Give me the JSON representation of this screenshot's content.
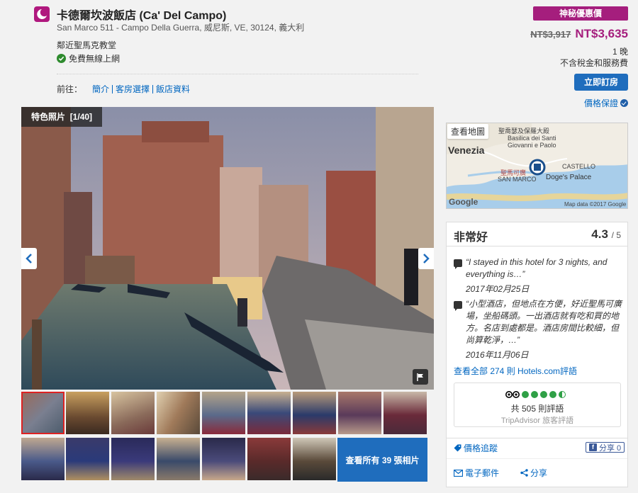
{
  "hotel": {
    "name": "卡德爾坎波飯店 (Ca' Del Campo)",
    "address": "San Marco 511 - Campo Della Guerra, 威尼斯, VE, 30124, 義大利",
    "landmark": "鄰近聖馬克教堂",
    "amenity": "免費無線上網"
  },
  "nav": {
    "prefix": "前往：",
    "links": [
      "簡介",
      "客房選擇",
      "飯店資料"
    ]
  },
  "price": {
    "badge": "神秘優惠價",
    "old": "NT$3,917",
    "new": "NT$3,635",
    "nights": "1 晚",
    "tax_note": "不含稅金和服務費",
    "book_button": "立即訂房",
    "guarantee": "價格保證"
  },
  "gallery": {
    "tag": "特色照片",
    "counter": "[1/40]",
    "view_all": "查看所有 39 張相片"
  },
  "map": {
    "button": "查看地圖",
    "labels": {
      "venezia": "Venezia",
      "basilica": "聖喬瑟及保羅大殿",
      "basilica_en": "Basilica dei Santi",
      "basilica_en2": "Giovanni e Paolo",
      "castello": "CASTELLO",
      "square": "聖馬可廣",
      "san_marco": "SAN MARCO",
      "doges": "Doge's Palace",
      "google": "Google",
      "credit": "Map data ©2017 Google"
    }
  },
  "reviews": {
    "title": "非常好",
    "score": "4.3",
    "out_of": "/ 5",
    "items": [
      {
        "text": "“I stayed in this hotel for 3 nights, and everything is…”",
        "date": "2017年02月25日"
      },
      {
        "text": "“小型酒店，但地点在方便，好近聖馬可廣場，坐船碼頭。一出酒店就有吃和買的地方。名店到處都是。酒店房間比較細，但尚算乾淨，…”",
        "date": "2016年11月06日"
      }
    ],
    "see_all": "查看全部 274 則 Hotels.com評語",
    "tripadvisor_count": "共 505 則評語",
    "tripadvisor_name": "TripAdvisor 旅客評語"
  },
  "tools": {
    "price_track": "價格追蹤",
    "fb_share": "分享 0",
    "email": "電子郵件",
    "share": "分享"
  },
  "colors": {
    "brand": "#a51e7d",
    "link": "#0066c0",
    "button": "#1f6dbd",
    "tripadvisor_green": "#2fa046"
  }
}
